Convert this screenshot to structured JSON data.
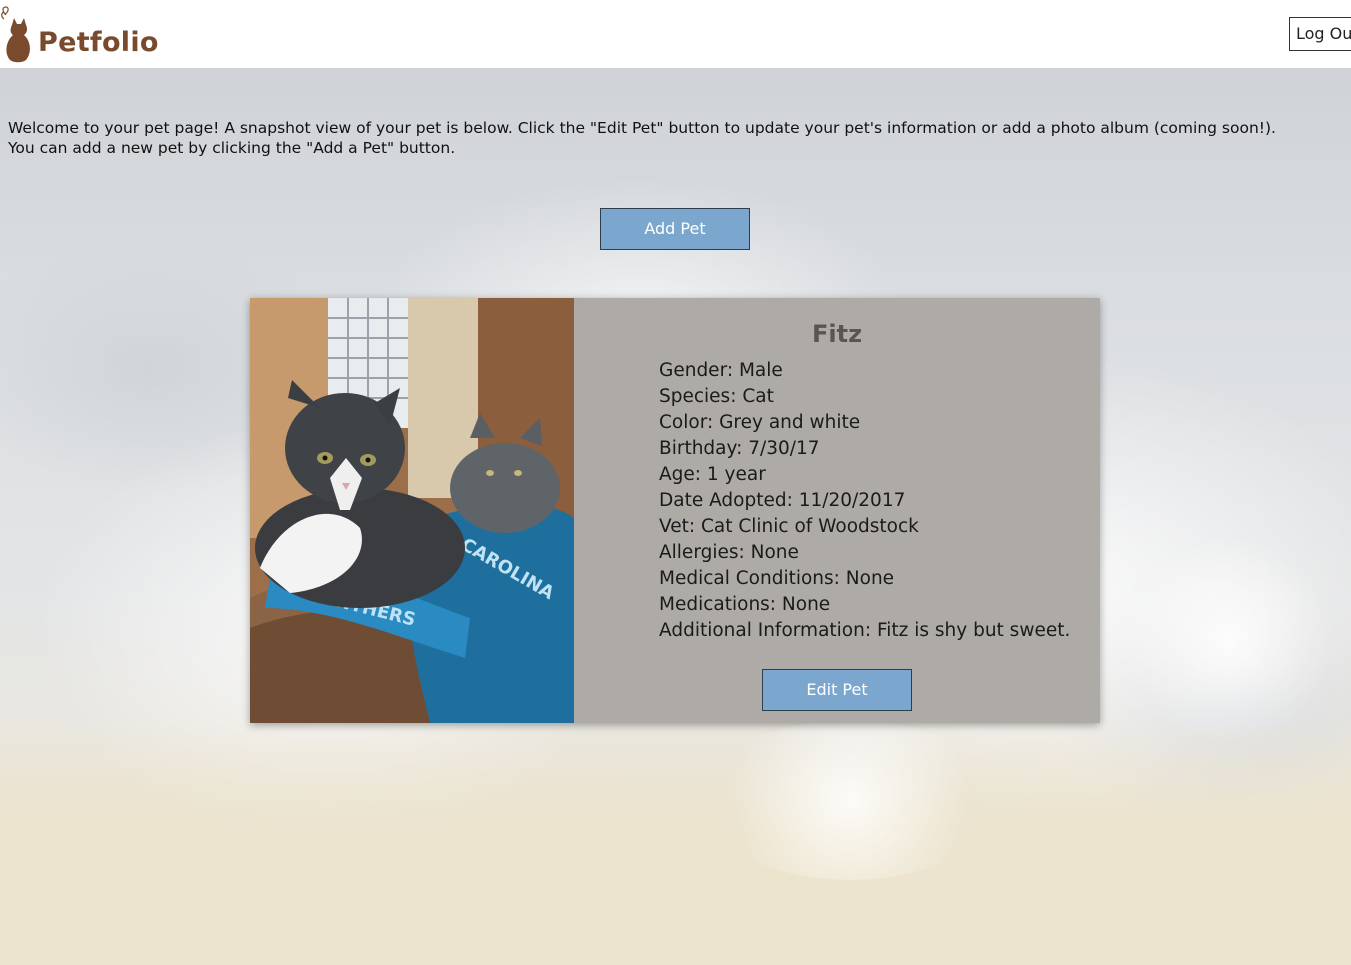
{
  "header": {
    "logo_text": "Petfolio",
    "logout_label": "Log Out"
  },
  "intro": {
    "line1": "Welcome to your pet page! A snapshot view of your pet is below. Click the \"Edit Pet\" button to update your pet's information or add a photo album (coming soon!).",
    "line2": "You can add a new pet by clicking the \"Add a Pet\" button."
  },
  "add_pet_label": "Add Pet",
  "pet": {
    "name": "Fitz",
    "fields": [
      "Gender: Male",
      "Species: Cat",
      "Color: Grey and white",
      "Birthday: 7/30/17",
      "Age: 1 year",
      "Date Adopted: 11/20/2017",
      "Vet: Cat Clinic of Woodstock",
      "Allergies: None",
      "Medical Conditions: None",
      "Medications: None",
      "Additional Information: Fitz is shy but sweet."
    ],
    "edit_label": "Edit Pet"
  },
  "colors": {
    "brand": "#7a4a2c",
    "button": "#7ba7ce",
    "card": "#aeaaa6"
  }
}
